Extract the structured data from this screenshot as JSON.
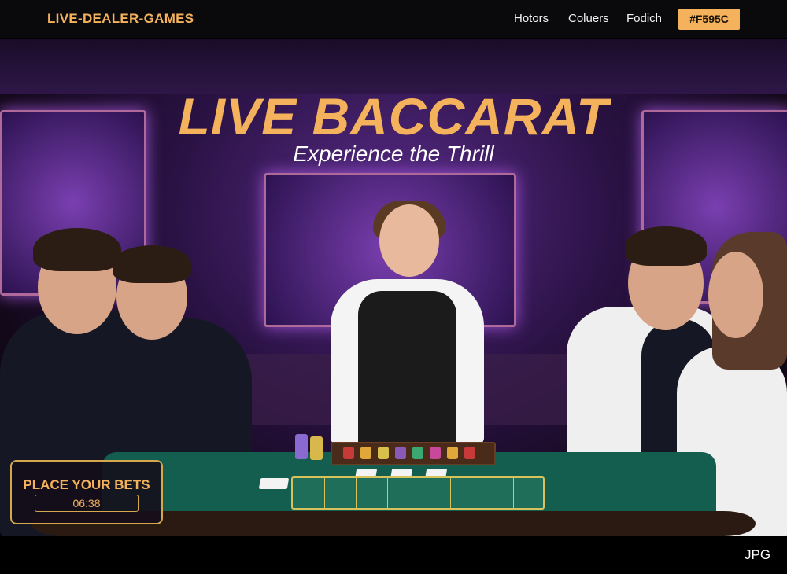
{
  "header": {
    "logo": "LIVE-DEALER-GAMES",
    "nav": [
      "Hotors",
      "Coluers",
      "Fodich"
    ],
    "badge": "#F595C"
  },
  "hero": {
    "title": "LIVE BACCARAT",
    "subtitle": "Experience the Thrill"
  },
  "bets": {
    "label": "PLACE YOUR BETS",
    "timer": "06:38"
  },
  "footer": {
    "format_label": "JPG"
  },
  "colors": {
    "accent": "#F5B25C",
    "felt": "#145e4f",
    "background": "#000000"
  }
}
